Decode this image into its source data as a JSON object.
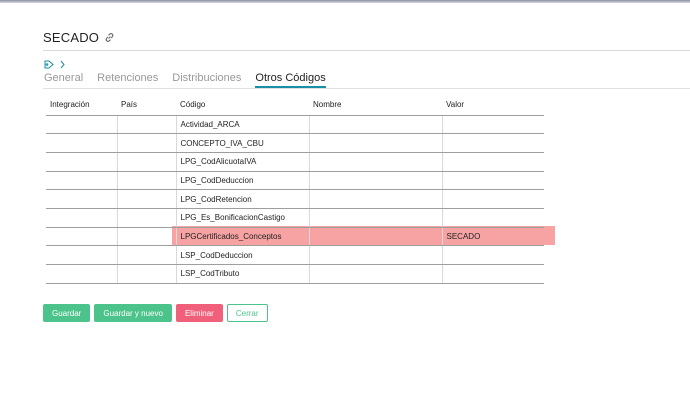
{
  "colors": {
    "accent": "#1a8fa8",
    "primary_button": "#4cc38a",
    "danger_button": "#f0607a",
    "highlight_row": "#f7a3a3"
  },
  "header": {
    "title": "SECADO",
    "title_icon": "link-icon",
    "tag_icon": "tag-icon",
    "tag_chevron": "chevron-right-icon"
  },
  "tabs": [
    {
      "label": "General",
      "active": false
    },
    {
      "label": "Retenciones",
      "active": false
    },
    {
      "label": "Distribuciones",
      "active": false
    },
    {
      "label": "Otros Códigos",
      "active": true
    }
  ],
  "table": {
    "columns": [
      "Integración",
      "País",
      "Código",
      "Nombre",
      "Valor"
    ],
    "rows": [
      {
        "integracion": "",
        "pais": "",
        "codigo": "Actividad_ARCA",
        "nombre": "",
        "valor": "",
        "selected": false
      },
      {
        "integracion": "",
        "pais": "",
        "codigo": "CONCEPTO_IVA_CBU",
        "nombre": "",
        "valor": "",
        "selected": false
      },
      {
        "integracion": "",
        "pais": "",
        "codigo": "LPG_CodAlicuotaIVA",
        "nombre": "",
        "valor": "",
        "selected": false
      },
      {
        "integracion": "",
        "pais": "",
        "codigo": "LPG_CodDeduccion",
        "nombre": "",
        "valor": "",
        "selected": false
      },
      {
        "integracion": "",
        "pais": "",
        "codigo": "LPG_CodRetencion",
        "nombre": "",
        "valor": "",
        "selected": false
      },
      {
        "integracion": "",
        "pais": "",
        "codigo": "LPG_Es_BonificacionCastigo",
        "nombre": "",
        "valor": "",
        "selected": false
      },
      {
        "integracion": "",
        "pais": "",
        "codigo": "LPGCertificados_Conceptos",
        "nombre": "",
        "valor": "SECADO",
        "selected": true
      },
      {
        "integracion": "",
        "pais": "",
        "codigo": "LSP_CodDeduccion",
        "nombre": "",
        "valor": "",
        "selected": false
      },
      {
        "integracion": "",
        "pais": "",
        "codigo": "LSP_CodTributo",
        "nombre": "",
        "valor": "",
        "selected": false
      }
    ]
  },
  "actions": {
    "save": "Guardar",
    "save_new": "Guardar y nuevo",
    "delete": "Eliminar",
    "close": "Cerrar"
  }
}
